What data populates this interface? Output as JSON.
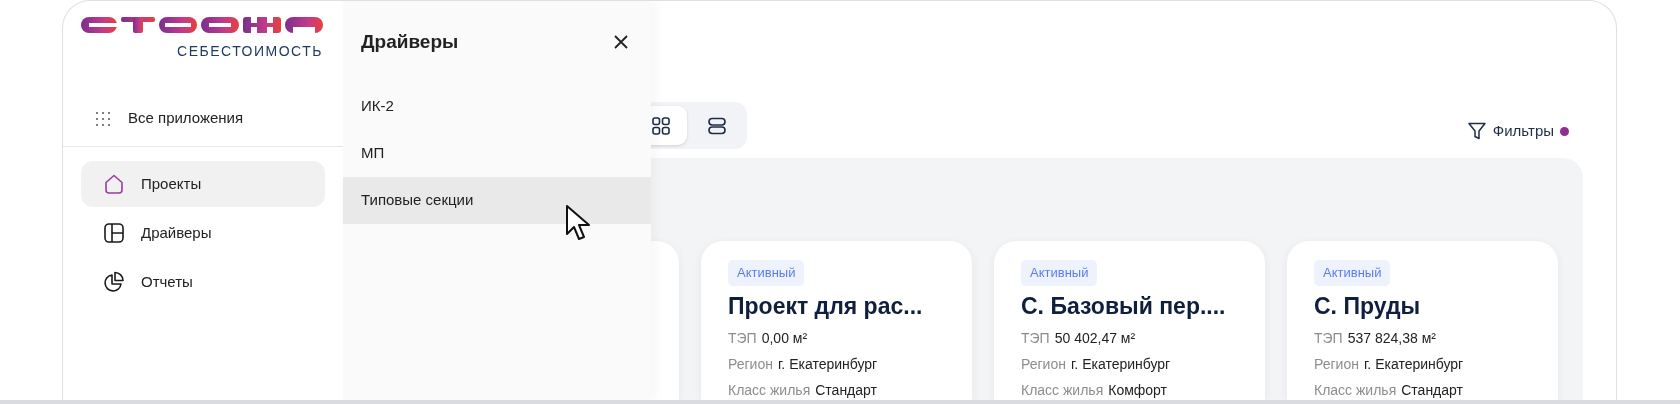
{
  "logo": {
    "subtitle": "СЕБЕСТОИМОСТЬ"
  },
  "sidebar": {
    "all_apps": "Все приложения",
    "items": [
      {
        "label": "Проекты",
        "kind": "home",
        "selected": true
      },
      {
        "label": "Драйверы",
        "kind": "layout",
        "selected": false
      },
      {
        "label": "Отчеты",
        "kind": "pie",
        "selected": false
      }
    ]
  },
  "flyout": {
    "title": "Драйверы",
    "items": [
      {
        "label": "ИК-2",
        "selected": false
      },
      {
        "label": "МП",
        "selected": false
      },
      {
        "label": "Типовые секции",
        "selected": true
      }
    ]
  },
  "view_toggle": [
    {
      "kind": "grid",
      "selected": true
    },
    {
      "kind": "list",
      "selected": false
    }
  ],
  "filters": {
    "label": "Фильтры",
    "active": true
  },
  "cards": [
    {
      "status": "Активный",
      "title": "Проект для рас...",
      "fields": [
        {
          "label": "ТЭП",
          "value": "0,00 м²"
        },
        {
          "label": "Регион",
          "value": "г. Екатеринбург"
        },
        {
          "label": "Класс жилья",
          "value": "Стандарт"
        }
      ]
    },
    {
      "status": "Активный",
      "title": "С. Базовый пер....",
      "fields": [
        {
          "label": "ТЭП",
          "value": "50 402,47 м²"
        },
        {
          "label": "Регион",
          "value": "г. Екатеринбург"
        },
        {
          "label": "Класс жилья",
          "value": "Комфорт"
        }
      ]
    },
    {
      "status": "Активный",
      "title": "С. Пруды",
      "fields": [
        {
          "label": "ТЭП",
          "value": "537 824,38 м²"
        },
        {
          "label": "Регион",
          "value": "г. Екатеринбург"
        },
        {
          "label": "Класс жилья",
          "value": "Стандарт"
        }
      ]
    }
  ]
}
